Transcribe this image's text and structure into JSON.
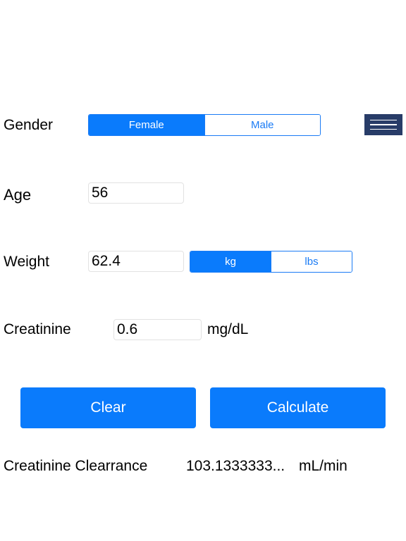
{
  "gender": {
    "label": "Gender",
    "options": [
      "Female",
      "Male"
    ],
    "selected": "Female"
  },
  "menu": {
    "icon": "hamburger-menu-icon"
  },
  "age": {
    "label": "Age",
    "value": "56"
  },
  "weight": {
    "label": "Weight",
    "value": "62.4",
    "units": [
      "kg",
      "lbs"
    ],
    "selected_unit": "kg"
  },
  "creatinine": {
    "label": "Creatinine",
    "value": "0.6",
    "unit": "mg/dL"
  },
  "buttons": {
    "clear": "Clear",
    "calculate": "Calculate"
  },
  "result": {
    "label": "Creatinine Clearrance",
    "value": "103.1333333...",
    "unit": "mL/min"
  },
  "colors": {
    "accent": "#0a7bfc",
    "menu_bg": "#283c68"
  }
}
